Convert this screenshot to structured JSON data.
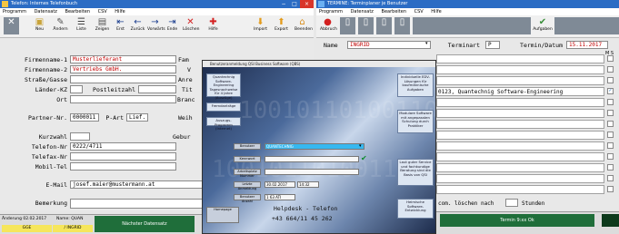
{
  "left_window": {
    "title": "Telefon: Internes Telefonbuch",
    "menu": [
      "Programm",
      "Datensatz",
      "Bearbeiten",
      "CSV",
      "Hilfe"
    ],
    "toolbar": [
      {
        "label": "",
        "icon": "close-x-icon"
      },
      {
        "label": "Neu",
        "icon": "new-icon"
      },
      {
        "label": "Ändern",
        "icon": "edit-icon"
      },
      {
        "label": "Liste",
        "icon": "list-icon"
      },
      {
        "label": "Zeigen",
        "icon": "show-icon"
      },
      {
        "label": "Erst",
        "icon": "first-icon"
      },
      {
        "label": "Zurück",
        "icon": "back-icon"
      },
      {
        "label": "Vorwärts",
        "icon": "forward-icon"
      },
      {
        "label": "Ende",
        "icon": "last-icon"
      },
      {
        "label": "Löschen",
        "icon": "delete-icon"
      },
      {
        "label": "Hilfe",
        "icon": "help-icon"
      },
      {
        "label": "Import",
        "icon": "import-icon"
      },
      {
        "label": "Export",
        "icon": "export-icon"
      },
      {
        "label": "Beenden",
        "icon": "home-exit-icon"
      }
    ],
    "fields": {
      "firmenname1_label": "Firmenname-1",
      "firmenname1_value": "Musterlieferant",
      "firmenname2_label": "Firmenname-2",
      "firmenname2_value": "Vertriebs GmbH.",
      "strasse_label": "Straße/Gasse",
      "laender_label": "Länder-KZ",
      "postleitzahl_label": "Postleitzahl",
      "ort_label": "Ort",
      "partner_label": "Partner-Nr.",
      "partner_value": "0000011",
      "part_label": "P-Art",
      "part_value": "Lief.",
      "kurzwahl_label": "Kurzwahl",
      "telefon_label": "Telefon-Nr",
      "telefon_value": "0222/4711",
      "telefax_label": "Telefax-Nr",
      "mobil_label": "Mobil-Tel",
      "email_label": "E-Mail",
      "email_value": "josef.maier@mustermann.at",
      "bemerkung_label": "Bemerkung",
      "right_labels": [
        "Fam",
        "V",
        "Anre",
        "Tit",
        "Branc",
        "Weih",
        "Gebur"
      ]
    },
    "status": {
      "aenderung": "Änderung 02.02.2017",
      "name": "Name: QUAN",
      "left_tag": "GGE",
      "mid_tag": "/ INGRID",
      "next_btn": "Nächster Datensatz"
    }
  },
  "right_window": {
    "title": "TERMINE: Terminplaner je Benutzer",
    "menu": [
      "Programm",
      "Datensatz",
      "Bearbeiten",
      "CSV",
      "Hilfe"
    ],
    "toolbar": [
      {
        "label": "Abbruch",
        "icon": "stop-icon"
      },
      {
        "label": "",
        "icon": "page-icon"
      },
      {
        "label": "",
        "icon": "page-icon"
      },
      {
        "label": "",
        "icon": "page-icon"
      },
      {
        "label": "",
        "icon": "page-icon"
      },
      {
        "label": "Aufgaben",
        "icon": "tasks-icon"
      }
    ],
    "name_label": "Name",
    "name_value": "INGRID",
    "terminart_label": "Terminart",
    "terminart_value": "P",
    "termin_datum_label": "Termin/Datum",
    "termin_datum_value": "15.11.2017",
    "col_headers": "M S",
    "entry_text": "0123, Quantechnig Software-Engineering",
    "footer_text": "com. löschen nach",
    "footer_unit": "Stunden",
    "status_text": "Termin 9:xx Ok"
  },
  "dialog": {
    "title": "Benutzeranmeldung QSI Business Software (QBS)",
    "left_buttons": [
      "Quantechnig Software-Engineering Tagesnachweise für 4 Jahre (Auszüge)",
      "Fremdanträge",
      "Auszugs-Programm (Internet)"
    ],
    "right_buttons": [
      "Individuelle EDV-Lösungen für kaufmännische Aufgaben",
      "Modulare Software mit angepassten Schulung durch Praktiker",
      "Laut guter Service und fachkundige Beratung sind die Basis von QSI",
      "Heimische Software-Entwicklung"
    ],
    "field_labels": [
      "Benutzer",
      "Kennwort",
      "Arbeitsplatz Nummer",
      "Letzte Anmeldung",
      "Benutzer Anzahl",
      "Homepage"
    ],
    "user_value": "QUANTECHNIG",
    "date_value": "30.02.2017",
    "time_value": "14:32",
    "count_value": "1 63 ATI",
    "hotline_title": "Helpdesk - Telefon",
    "hotline_number": "+43 664/11 45 262",
    "bg_digits": "10010110100110"
  }
}
